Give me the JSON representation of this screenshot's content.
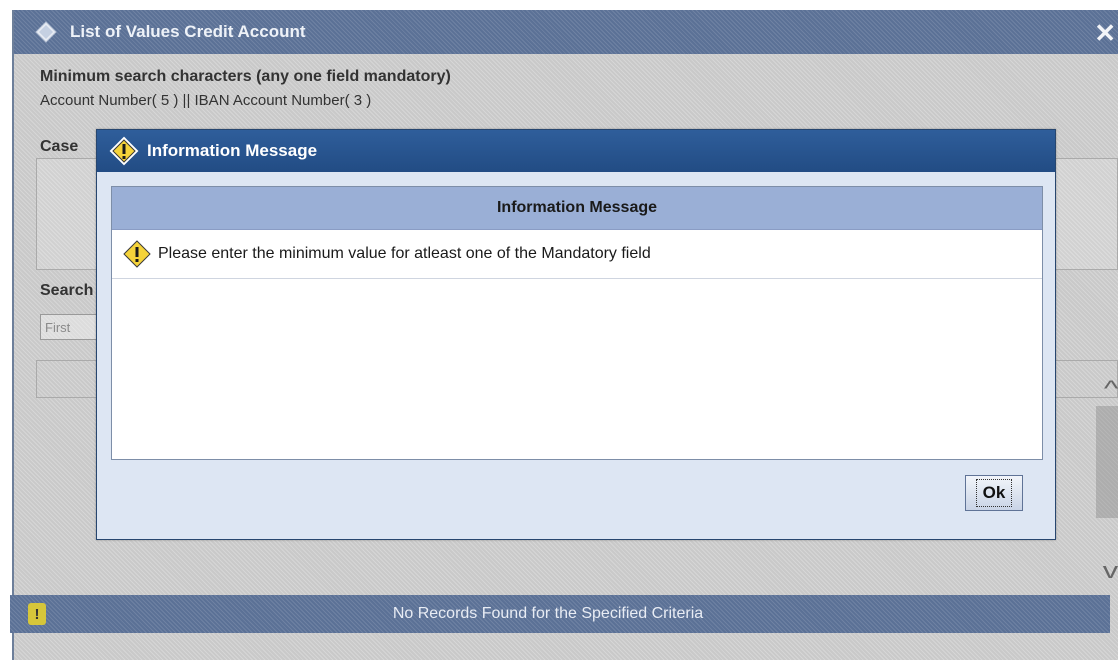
{
  "lov": {
    "title": "List of Values Credit Account",
    "close_glyph": "✕",
    "min_heading": "Minimum search characters (any one field mandatory)",
    "min_fields": "Account Number( 5 ) || IBAN Account Number( 3 )",
    "case_label": "Case",
    "search_label": "Search",
    "first_field_value": "First",
    "scroll_up_glyph": "^",
    "scroll_down_glyph": "v"
  },
  "status_bar": {
    "icon_glyph": "!",
    "message": "No Records Found for the Specified Criteria"
  },
  "modal": {
    "title": "Information Message",
    "header": "Information Message",
    "message": "Please enter the minimum value for atleast one of the Mandatory field",
    "ok_label": "Ok"
  },
  "colors": {
    "title_blue": "#2f5e9b",
    "header_blue": "#9aafd6",
    "warning_yellow": "#f5d33a"
  },
  "icons": {
    "lov_title_icon": "diamond-icon",
    "modal_title_icon": "warning-icon",
    "message_icon": "warning-icon",
    "status_icon": "exclamation-icon"
  }
}
